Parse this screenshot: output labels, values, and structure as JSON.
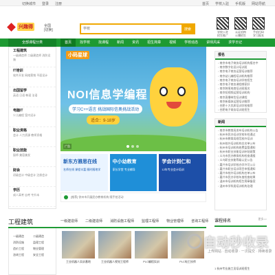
{
  "topbar": {
    "left": [
      "切换城市",
      "登录",
      "注册"
    ],
    "right": [
      "首页",
      "学校入驻",
      "手机版",
      "网站导航"
    ]
  },
  "header": {
    "logo_text": "兴趣得",
    "city_name": "全国",
    "city_switch": "[切换]",
    "search_placeholder": "学校",
    "search_button": "搜索",
    "qr_codes": [
      {
        "line1": "学校入驻",
        "line2": "招生推广"
      },
      {
        "line1": "认证机构",
        "line2": "火爆招生"
      },
      {
        "line1": "手机扫码",
        "line2": "学习报名"
      }
    ]
  },
  "nav": {
    "all_categories": "全部课程分类",
    "items": [
      "首页",
      "找学校",
      "找课程",
      "新闻",
      "资讯",
      "招生简章",
      "视频",
      "学校动态",
      "讲师风采",
      "求学日记"
    ],
    "active_index": 0
  },
  "sidebar": [
    {
      "title": "工程建筑",
      "sub": "一级建造师 二级建造师 消防设施"
    },
    {
      "title": "IT培训",
      "sub": "软件开发 网络营销 平面设计"
    },
    {
      "title": "出国留学",
      "sub": "英语 日语 韩语 法语"
    },
    {
      "title": "电脑IT",
      "sub": "少儿编程 室内设计"
    },
    {
      "title": "职业资格",
      "sub": "会计 人力资源 教师资格"
    },
    {
      "title": "职业技能",
      "sub": "厨师 美容美发"
    },
    {
      "title": "财会",
      "sub": "初级会计 中级会计 注册会计"
    },
    {
      "title": "学历",
      "sub": "成人高考 自考 专升本"
    },
    {
      "title": "青少年认知",
      "sub": "编程 机器人 美术"
    }
  ],
  "banner": {
    "logo": "小码星球",
    "title": "NOI信息学编程",
    "subtitle": "学习C++语言 挑战国际信奥挑战活动",
    "age": "适合：9-18岁",
    "ad_label": "广告"
  },
  "promos": [
    {
      "title": "新东方雅思在线",
      "sub": "名师在线 课程丰富 随时随地学",
      "bg": "#eaf4ff",
      "color": "#1d5fb3"
    },
    {
      "title": "中小幼教育",
      "sub": "家长学堂 专业辅导",
      "bg": "#1f8fd8",
      "color": "#ffffff"
    },
    {
      "title": "学会计到仁和",
      "sub": "12年专业会计培训",
      "bg": "#1d4fa8",
      "color": "#ffffff"
    }
  ],
  "news_ticker": "[推荐] 徐州市开展民办教育机构 随手拍活动 ",
  "right_panels": [
    {
      "title": "报名",
      "items": [
        "南京市电子商务培训机构报名中",
        "南京数字化设计培训班",
        "南京电子商务运营培训推荐",
        "南京幼儿编程培训机构推荐",
        "南京电子商务培训学校招生",
        "南京电子商务课程哪家好",
        "南京跨境电商培训班报名",
        "南京短视频运营培训机构",
        "南京直播带货培训课程",
        "南京新媒体运营培训推荐",
        "合肥十大优质培训学校推荐",
        "合肥电子商务培训班招生"
      ]
    },
    {
      "title": "新闻",
      "items": [
        "南京市教育局发布培训机构公告",
        "杭州市民办培训学校年检通过",
        "杭州市教育局规范校外培训",
        "杭州校外培训机构白名单公布",
        "杭州市培训机构收费监管通知",
        "杭州市职业技能培训补贴政策",
        "义乌市民办教育机构检查通报",
        "义乌职业技能等级认定公告",
        "嘉兴市培训学校办学许可公示",
        "嘉兴市职业培训项目申报通知",
        "嘉兴市校外培训机构名单公布",
        "嘉兴市民办学校年度检查结果",
        "温州市培训机构招生简章备案",
        "温州市学科类培训机构治理"
      ]
    }
  ],
  "section": {
    "title": "工程建筑",
    "tabs": [
      "一级建造师",
      "二级建造师",
      "消防设施工程师",
      "监理工程师",
      "物业管理师",
      "咨询工程师"
    ],
    "side_links": [
      "一级建造",
      "二级建造",
      "消防设施",
      "监理工程",
      "造价工程",
      "物业管理",
      "咨询工程",
      "安全工程"
    ],
    "thumbs": [
      {
        "caption": "工业机器人实训基地"
      },
      {
        "caption": "工业机器人视觉工程师"
      },
      {
        "caption": "PLC编程实训"
      },
      {
        "caption": "PLC电工技师"
      }
    ],
    "rank_title": "课程排名",
    "rank_more": "更多>>",
    "rank_item": "1 杭州专业施工员培训班招生"
  },
  "watermark": {
    "main": "自动秒收录",
    "sub": "上传网站 · 自动收录 · 一次提交 · 持续收录"
  },
  "colors": {
    "brand_green": "#1e9a33",
    "accent_orange": "#f0a800"
  }
}
